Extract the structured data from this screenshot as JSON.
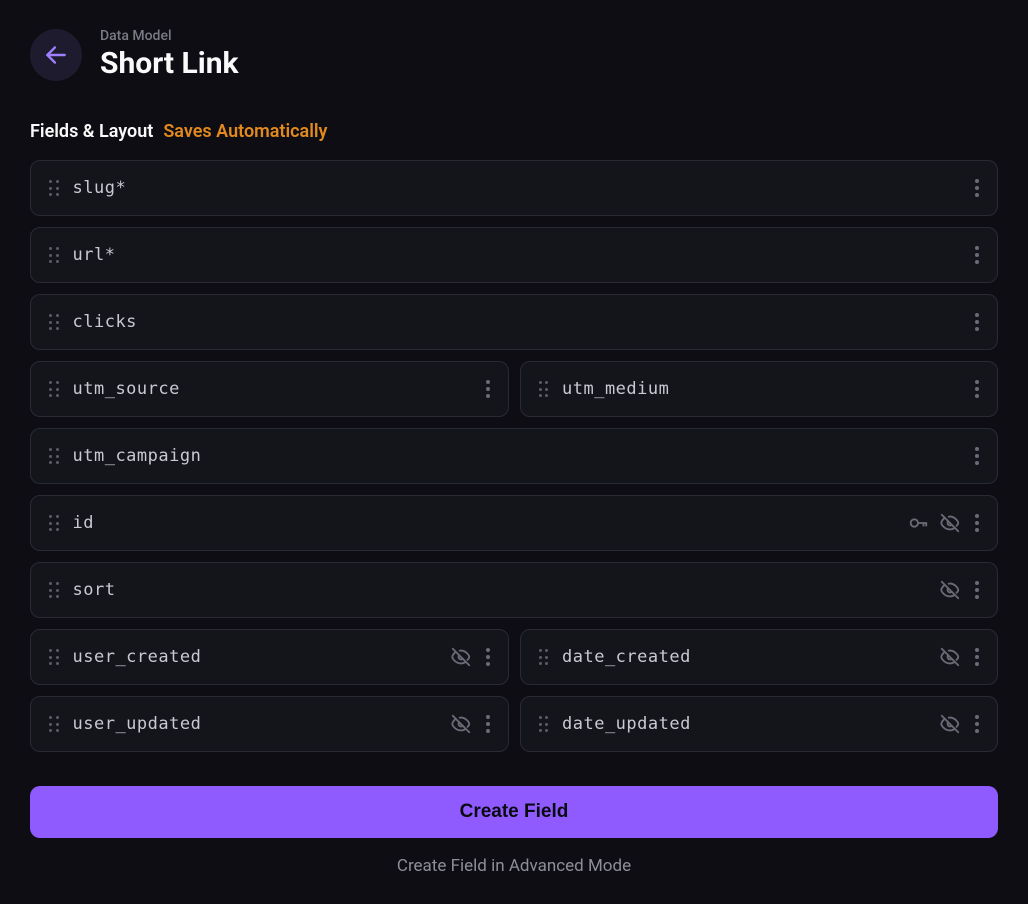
{
  "header": {
    "eyebrow": "Data Model",
    "title": "Short Link"
  },
  "section": {
    "title": "Fields & Layout",
    "hint": "Saves Automatically"
  },
  "fields": {
    "slug": "slug*",
    "url": "url*",
    "clicks": "clicks",
    "utm_source": "utm_source",
    "utm_medium": "utm_medium",
    "utm_campaign": "utm_campaign",
    "id": "id",
    "sort": "sort",
    "user_created": "user_created",
    "date_created": "date_created",
    "user_updated": "user_updated",
    "date_updated": "date_updated"
  },
  "actions": {
    "create": "Create Field",
    "advanced": "Create Field in Advanced Mode"
  }
}
